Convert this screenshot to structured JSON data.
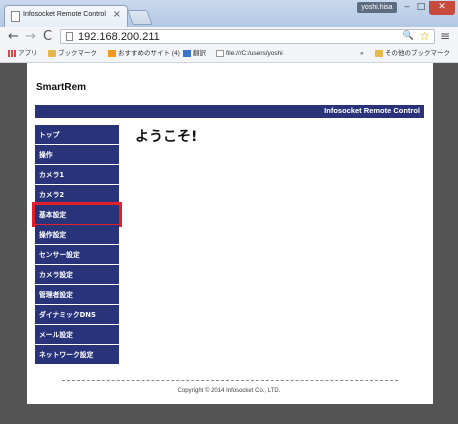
{
  "browser": {
    "tab_title": "Infosocket Remote Control",
    "tab_close": "×",
    "user_button": "yoshi.hisa",
    "window_min": "‒",
    "window_max": "□",
    "window_close": "✕",
    "nav_back": "←",
    "nav_forward": "→",
    "nav_reload": "C",
    "url": "192.168.200.211",
    "zoom_icon": "🔍",
    "star": "☆",
    "menu": "≡"
  },
  "bookmarks": {
    "apps": "アプリ",
    "bookmarks": "ブックマーク",
    "recommended": "おすすめのサイト (4)",
    "translate": "翻訳",
    "file_path": "file:///C:/users/yoshi",
    "more": "»",
    "other": "その他のブックマーク"
  },
  "page": {
    "site_title": "SmartRem",
    "banner": "Infosocket Remote Control",
    "welcome": "ようこそ!",
    "footer": "Copyright © 2014 Infosocket Co., LTD.",
    "nav": [
      {
        "label": "トップ"
      },
      {
        "label": "操作"
      },
      {
        "label": "カメラ1"
      },
      {
        "label": "カメラ2"
      },
      {
        "label": "基本設定"
      },
      {
        "label": "操作設定"
      },
      {
        "label": "センサー設定"
      },
      {
        "label": "カメラ設定"
      },
      {
        "label": "管理者設定"
      },
      {
        "label": "ダイナミックDNS"
      },
      {
        "label": "メール設定"
      },
      {
        "label": "ネットワーク設定"
      }
    ],
    "selected_nav": "基本設定"
  },
  "colors": {
    "nav_bg": "#29337a",
    "highlight": "#e0202a"
  }
}
